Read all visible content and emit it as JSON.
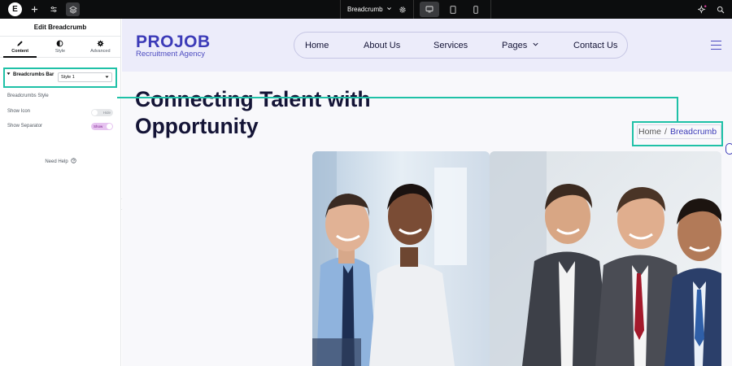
{
  "topbar": {
    "document_title": "Breadcrumb",
    "icons": [
      "elementor-logo-icon",
      "plus-icon",
      "sliders-icon",
      "layers-icon",
      "chevron-down-icon",
      "gear-icon",
      "desktop-icon",
      "tablet-icon",
      "mobile-icon",
      "sparkle-icon",
      "search-icon"
    ]
  },
  "panel": {
    "title": "Edit Breadcrumb",
    "tabs": [
      {
        "label": "Content",
        "icon": "pencil-icon"
      },
      {
        "label": "Style",
        "icon": "half-circle-icon"
      },
      {
        "label": "Advanced",
        "icon": "gear-icon"
      }
    ],
    "section_title": "Breadcrumbs Bar",
    "style_label": "Breadcrumbs Style",
    "style_value": "Style 1",
    "show_icon_label": "Show Icon",
    "show_icon_state": "Hide",
    "show_separator_label": "Show Separator",
    "show_separator_state": "Show",
    "help_label": "Need Help"
  },
  "site": {
    "logo_main": "PROJOB",
    "logo_sub": "Recruitment Agency",
    "nav": [
      "Home",
      "About Us",
      "Services",
      "Pages",
      "Contact Us"
    ],
    "hero_title_line1": "Connecting Talent with",
    "hero_title_line2": "Opportunity",
    "breadcrumb_home": "Home",
    "breadcrumb_separator": "/",
    "breadcrumb_current": "Breadcrumb"
  },
  "colors": {
    "accent": "#3c3bb8",
    "highlight": "#1fc1a7",
    "dark": "#141436",
    "topbar": "#0c0d0e"
  }
}
